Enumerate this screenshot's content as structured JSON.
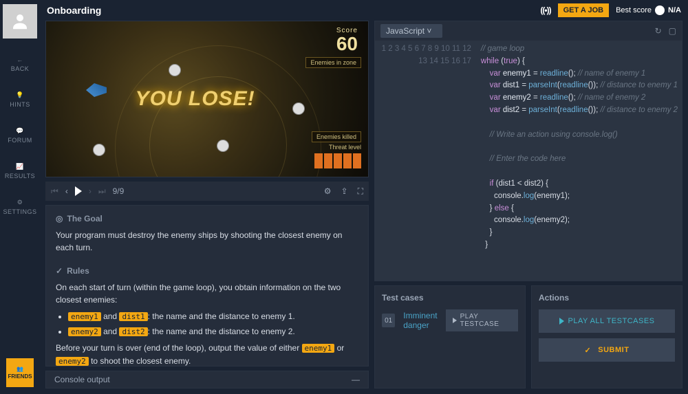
{
  "header": {
    "title": "Onboarding",
    "get_job": "GET A JOB",
    "best_score_label": "Best score",
    "best_score_value": "N/A"
  },
  "sidebar": {
    "back": "BACK",
    "hints": "HINTS",
    "forum": "FORUM",
    "results": "RESULTS",
    "settings": "SETTINGS",
    "friends": "FRIENDS"
  },
  "viewer": {
    "lose_text": "YOU LOSE!",
    "score_label": "Score",
    "score_value": "60",
    "enemies_zone": "Enemies in zone",
    "enemies_killed": "Enemies killed",
    "threat": "Threat level"
  },
  "playbar": {
    "frame": "9/9"
  },
  "instructions": {
    "goal_head": "The Goal",
    "goal_text": "Your program must destroy the enemy ships by shooting the closest enemy on each turn.",
    "rules_head": "Rules",
    "rules_intro": "On each start of turn (within the game loop), you obtain information on the two closest enemies:",
    "bullet1_a": "enemy1",
    "bullet1_b": "dist1",
    "bullet1_c": ": the name and the distance to enemy 1.",
    "bullet2_a": "enemy2",
    "bullet2_b": "dist2",
    "bullet2_c": ": the name and the distance to enemy 2.",
    "rules_out_a": "Before your turn is over (end of the loop), output the value of either ",
    "rules_out_b": "enemy1",
    "rules_out_c": " or ",
    "rules_out_d": "enemy2",
    "rules_out_e": " to shoot the closest enemy."
  },
  "console": {
    "title": "Console output"
  },
  "editor": {
    "language": "JavaScript",
    "lines": 17
  },
  "testcases": {
    "title": "Test cases",
    "items": [
      {
        "num": "01",
        "name": "Imminent danger"
      }
    ],
    "play_label": "PLAY TESTCASE"
  },
  "actions": {
    "title": "Actions",
    "play_all": "PLAY ALL TESTCASES",
    "submit": "SUBMIT"
  }
}
